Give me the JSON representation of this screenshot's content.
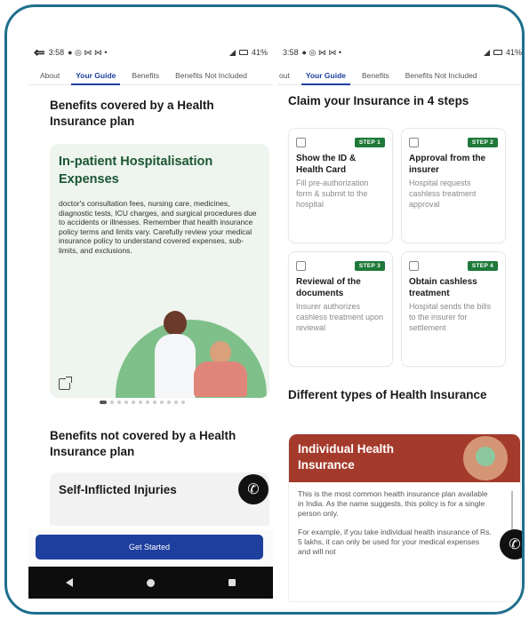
{
  "left": {
    "status": {
      "time": "3:58",
      "battery": "41%"
    },
    "tabs": [
      "About",
      "Your Guide",
      "Benefits",
      "Benefits Not Included"
    ],
    "benefits_title": "Benefits covered by a Health Insurance plan",
    "card": {
      "title": "In-patient Hospitalisation Expenses",
      "description": "doctor's consultation fees, nursing care, medicines, diagnostic tests, ICU charges, and surgical procedures due to accidents or illnesses. Remember that health insurance policy terms and limits vary. Carefully review your medical insurance policy to understand covered expenses, sub-limits, and exclusions."
    },
    "not_covered_title": "Benefits not covered by a Health Insurance plan",
    "not_covered_card": {
      "title": "Self-Inflicted Injuries"
    },
    "cta": "Get Started"
  },
  "right": {
    "status": {
      "time": "3:58",
      "battery": "41%"
    },
    "tabs": [
      "out",
      "Your Guide",
      "Benefits",
      "Benefits Not Included"
    ],
    "claim_title": "Claim your Insurance in 4 steps",
    "steps": [
      {
        "badge": "STEP 1",
        "title": "Show the ID & Health Card",
        "desc": "Fill pre-authorization form & submit to the hospital"
      },
      {
        "badge": "STEP 2",
        "title": "Approval from the insurer",
        "desc": "Hospital requests cashless treatment approval"
      },
      {
        "badge": "STEP 3",
        "title": "Reviewal of the documents",
        "desc": "Insurer authorizes cashless treatment upon reviewal"
      },
      {
        "badge": "STEP 4",
        "title": "Obtain cashless treatment",
        "desc": "Hospital sends the bills to the insurer for settlement"
      }
    ],
    "types_title": "Different types of Health Insurance",
    "plan_card": {
      "title": "Individual Health Insurance",
      "para1": "This is the most common health insurance plan available in India. As the name suggests, this policy is for a single person only.",
      "para2": "For example, if you take individual health insurance of Rs. 5 lakhs, it can only be used for your medical expenses and will not"
    }
  },
  "colors": {
    "frame": "#1e6f8c",
    "primary": "#1e3f9e",
    "card_title_green": "#1a5632",
    "step_badge": "#1f7a3a",
    "plan_header": "#a43a2b"
  }
}
